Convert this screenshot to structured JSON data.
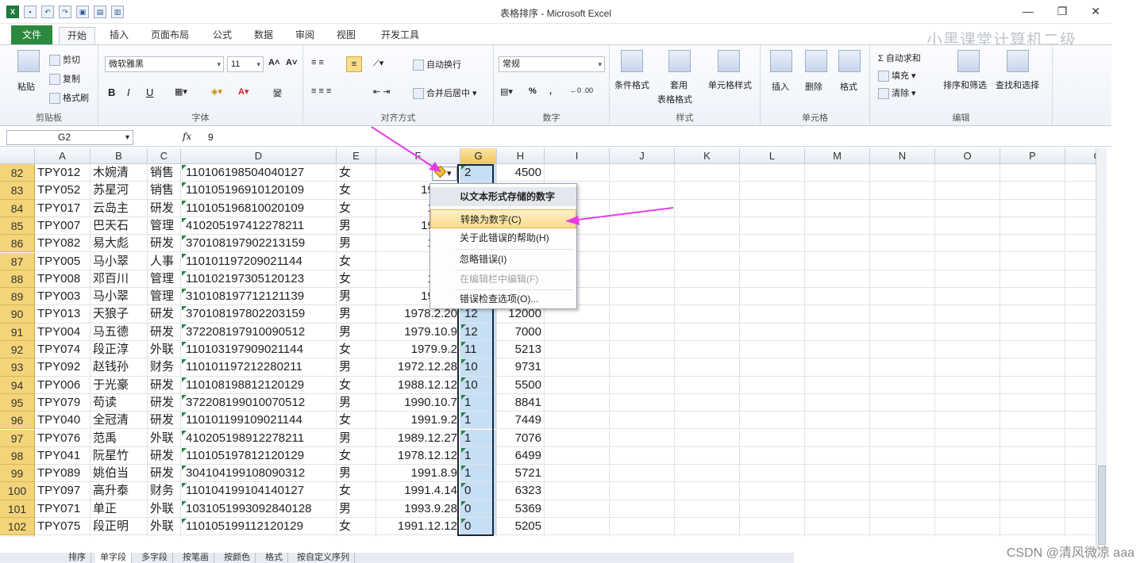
{
  "titlebar": {
    "title": "表格排序 - Microsoft Excel",
    "qat": [
      "X",
      "▪",
      "↶",
      "↷",
      "▣",
      "▤",
      "▥"
    ]
  },
  "ribbon": {
    "tabs": [
      "文件",
      "开始",
      "插入",
      "页面布局",
      "公式",
      "数据",
      "审阅",
      "视图",
      "开发工具"
    ],
    "active_tab": "开始",
    "watermark": "小黑课堂计算机二级",
    "clipboard": {
      "paste": "粘贴",
      "cut": "剪切",
      "copy": "复制",
      "format_painter": "格式刷",
      "label": "剪贴板"
    },
    "font": {
      "name": "微软雅黑",
      "size": "11",
      "bold": "B",
      "italic": "I",
      "underline": "U",
      "grow": "A˄",
      "shrink": "A˅",
      "wen": "變",
      "label": "字体"
    },
    "alignment": {
      "wrap": "自动换行",
      "merge": "合并后居中",
      "label": "对齐方式"
    },
    "number": {
      "format": "常规",
      "percent": "%",
      "comma": ",",
      "label": "数字"
    },
    "styles": {
      "cond": "条件格式",
      "table": "套用",
      "table2": "表格格式",
      "cell": "单元格样式",
      "label": "样式"
    },
    "cells": {
      "insert": "插入",
      "delete": "删除",
      "format": "格式",
      "label": "单元格"
    },
    "editing": {
      "autosum": "Σ 自动求和",
      "fill": "填充",
      "clear": "清除",
      "sort": "排序和筛选",
      "find": "查找和选择",
      "label": "编辑"
    }
  },
  "formula_bar": {
    "name_box": "G2",
    "fx": "fx",
    "value": "9"
  },
  "columns": [
    "A",
    "B",
    "C",
    "D",
    "E",
    "F",
    "G",
    "H",
    "I",
    "J",
    "K",
    "L",
    "M",
    "N",
    "O",
    "P",
    "Q"
  ],
  "rows": [
    {
      "n": "82",
      "a": "TPY012",
      "b": "木婉清",
      "c": "销售",
      "d": "110106198504040127",
      "e": "女",
      "f": "1985",
      "g": "2",
      "h": "4500"
    },
    {
      "n": "83",
      "a": "TPY052",
      "b": "苏星河",
      "c": "销售",
      "d": "110105196910120109",
      "e": "女",
      "f": "1969.1",
      "g": "",
      "h": ""
    },
    {
      "n": "84",
      "a": "TPY017",
      "b": "云岛主",
      "c": "研发",
      "d": "110105196810020109",
      "e": "女",
      "f": "1968.",
      "g": "",
      "h": ""
    },
    {
      "n": "85",
      "a": "TPY007",
      "b": "巴天石",
      "c": "管理",
      "d": "410205197412278211",
      "e": "男",
      "f": "1974.1",
      "g": "",
      "h": ""
    },
    {
      "n": "86",
      "a": "TPY082",
      "b": "易大彪",
      "c": "研发",
      "d": "370108197902213159",
      "e": "男",
      "f": "1979.",
      "g": "",
      "h": ""
    },
    {
      "n": "87",
      "a": "TPY005",
      "b": "马小翠",
      "c": "人事",
      "d": "110101197209021144",
      "e": "女",
      "f": "1972",
      "g": "",
      "h": ""
    },
    {
      "n": "88",
      "a": "TPY008",
      "b": "邓百川",
      "c": "管理",
      "d": "110102197305120123",
      "e": "女",
      "f": "1973.",
      "g": "",
      "h": ""
    },
    {
      "n": "89",
      "a": "TPY003",
      "b": "马小翠",
      "c": "管理",
      "d": "310108197712121139",
      "e": "男",
      "f": "1977.1",
      "g": "",
      "h": ""
    },
    {
      "n": "90",
      "a": "TPY013",
      "b": "天狼子",
      "c": "研发",
      "d": "370108197802203159",
      "e": "男",
      "f": "1978.2.20",
      "g": "12",
      "h": "12000"
    },
    {
      "n": "91",
      "a": "TPY004",
      "b": "马五德",
      "c": "研发",
      "d": "372208197910090512",
      "e": "男",
      "f": "1979.10.9",
      "g": "12",
      "h": "7000"
    },
    {
      "n": "92",
      "a": "TPY074",
      "b": "段正淳",
      "c": "外联",
      "d": "110103197909021144",
      "e": "女",
      "f": "1979.9.2",
      "g": "11",
      "h": "5213"
    },
    {
      "n": "93",
      "a": "TPY092",
      "b": "赵钱孙",
      "c": "财务",
      "d": "110101197212280211",
      "e": "男",
      "f": "1972.12.28",
      "g": "10",
      "h": "9731"
    },
    {
      "n": "94",
      "a": "TPY006",
      "b": "于光豪",
      "c": "研发",
      "d": "110108198812120129",
      "e": "女",
      "f": "1988.12.12",
      "g": "10",
      "h": "5500"
    },
    {
      "n": "95",
      "a": "TPY079",
      "b": "苟读",
      "c": "研发",
      "d": "372208199010070512",
      "e": "男",
      "f": "1990.10.7",
      "g": "1",
      "h": "8841"
    },
    {
      "n": "96",
      "a": "TPY040",
      "b": "全冠清",
      "c": "研发",
      "d": "110101199109021144",
      "e": "女",
      "f": "1991.9.2",
      "g": "1",
      "h": "7449"
    },
    {
      "n": "97",
      "a": "TPY076",
      "b": "范禹",
      "c": "外联",
      "d": "410205198912278211",
      "e": "男",
      "f": "1989.12.27",
      "g": "1",
      "h": "7076"
    },
    {
      "n": "98",
      "a": "TPY041",
      "b": "阮星竹",
      "c": "研发",
      "d": "110105197812120129",
      "e": "女",
      "f": "1978.12.12",
      "g": "1",
      "h": "6499"
    },
    {
      "n": "99",
      "a": "TPY089",
      "b": "姚伯当",
      "c": "研发",
      "d": "304104199108090312",
      "e": "男",
      "f": "1991.8.9",
      "g": "1",
      "h": "5721"
    },
    {
      "n": "100",
      "a": "TPY097",
      "b": "高升泰",
      "c": "财务",
      "d": "110104199104140127",
      "e": "女",
      "f": "1991.4.14",
      "g": "0",
      "h": "6323"
    },
    {
      "n": "101",
      "a": "TPY071",
      "b": "单正",
      "c": "外联",
      "d": "1031051993092840128",
      "e": "男",
      "f": "1993.9.28",
      "g": "0",
      "h": "5369"
    },
    {
      "n": "102",
      "a": "TPY075",
      "b": "段正明",
      "c": "外联",
      "d": "110105199112120129",
      "e": "女",
      "f": "1991.12.12",
      "g": "0",
      "h": "5205"
    },
    {
      "n": "103",
      "a": "",
      "b": "",
      "c": "",
      "d": "",
      "e": "",
      "f": "",
      "g": "",
      "h": ""
    }
  ],
  "context_menu": {
    "header": "以文本形式存储的数字",
    "items": [
      {
        "label": "转换为数字(C)",
        "state": "highlighted"
      },
      {
        "label": "关于此错误的帮助(H)",
        "state": "normal"
      },
      {
        "label": "忽略错误(I)",
        "state": "normal"
      },
      {
        "label": "在编辑栏中编辑(F)",
        "state": "disabled"
      },
      {
        "label": "错误检查选项(O)...",
        "state": "normal"
      }
    ]
  },
  "sheet_tabs": [
    "排序",
    "单字段",
    "多字段",
    "按笔画",
    "按颜色",
    "格式",
    "按自定义序列"
  ],
  "watermark_bottom": "CSDN @清风微凉 aaa",
  "colors": {
    "accent_file_tab": "#2a8a3e",
    "row_header_selected": "#f3d478",
    "col_g_fill": "#c7dff5",
    "menu_highlight": "#f8dc8c",
    "arrow": "#e63ce6"
  }
}
